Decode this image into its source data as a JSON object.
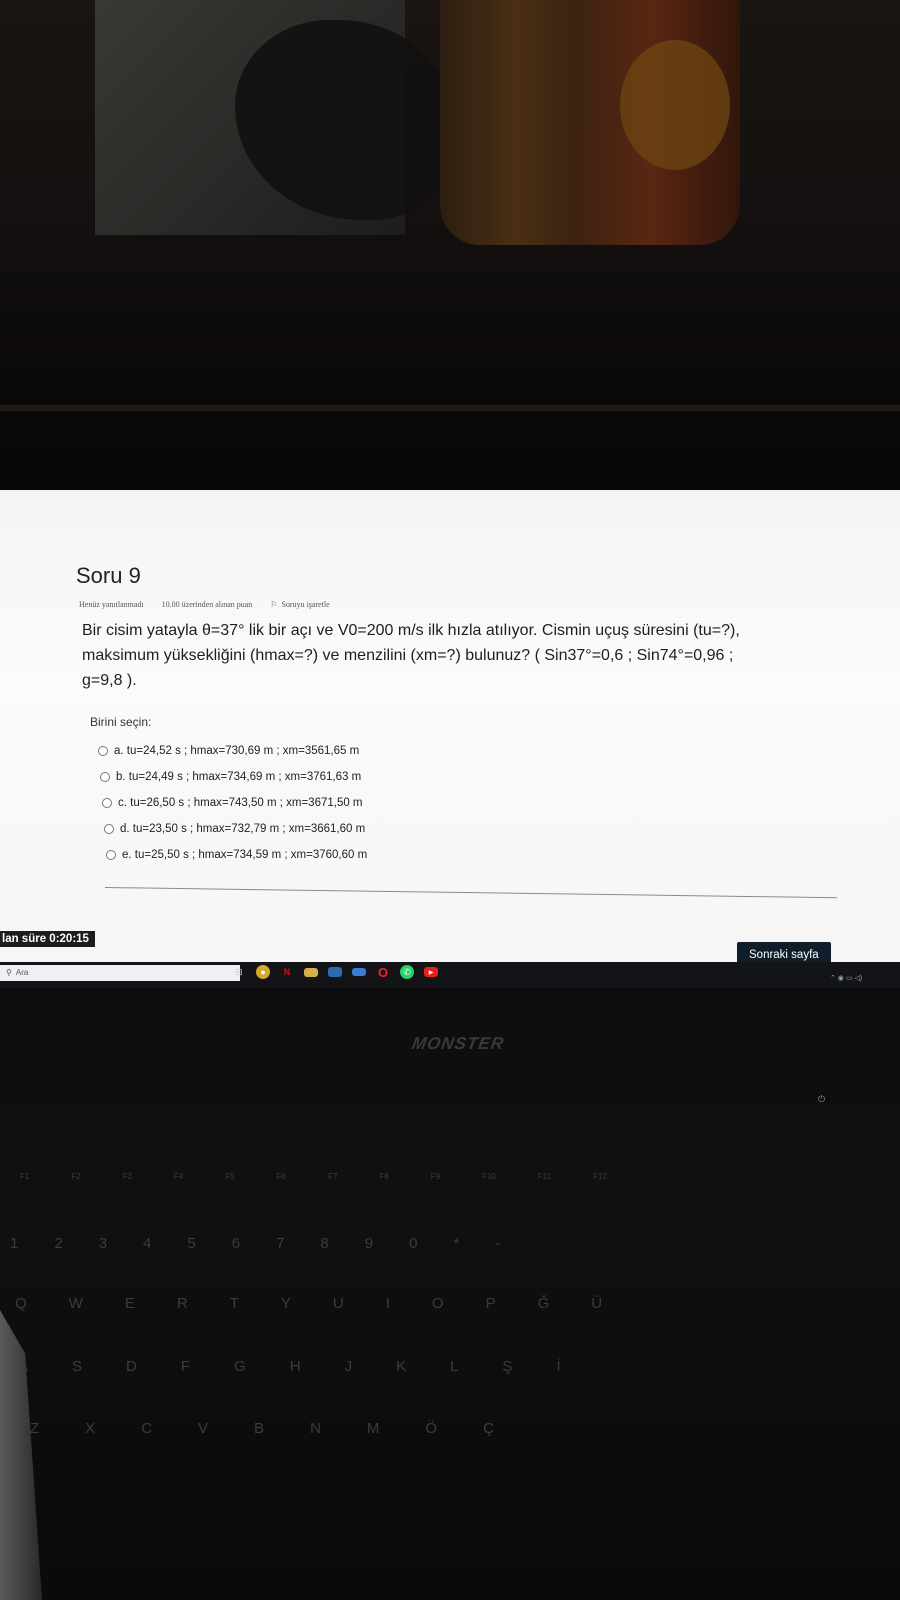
{
  "question": {
    "title": "Soru 9",
    "status": "Henüz yanıtlanmadı",
    "points": "10.00 üzerinden alınan puan",
    "flag_label": "Soruyu işaretle",
    "text_line1": "Bir cisim yatayla  θ=37° lik bir açı ve  V0=200 m/s ilk hızla atılıyor. Cismin uçuş süresini (tu=?),",
    "text_line2": "maksimum yüksekliğini (hmax=?) ve menzilini (xm=?) bulunuz? ( Sin37°=0,6 ;  Sin74°=0,96   ;",
    "text_line3": "g=9,8 )."
  },
  "answer": {
    "prompt": "Birini seçin:",
    "options": [
      {
        "label": "a. tu=24,52 s ;  hmax=730,69 m  ; xm=3561,65 m",
        "selected": false
      },
      {
        "label": "b. tu=24,49 s ;  hmax=734,69 m  ;  xm=3761,63 m",
        "selected": false
      },
      {
        "label": "c. tu=26,50 s ;  hmax=743,50 m  ; xm=3671,50 m",
        "selected": false
      },
      {
        "label": "d. tu=23,50 s ;  hmax=732,79 m  ; xm=3661,60 m",
        "selected": false
      },
      {
        "label": "e. tu=25,50 s ;  hmax=734,59 m  ; xm=3760,60 m",
        "selected": false
      }
    ]
  },
  "footer": {
    "timer": "lan süre 0:20:15",
    "next_button": "Sonraki sayfa"
  },
  "taskbar": {
    "search_placeholder": "Ara",
    "apps": [
      "task-view-icon",
      "chrome-icon",
      "netflix-icon",
      "file-explorer-icon",
      "store-icon",
      "mail-icon",
      "opera-icon",
      "whatsapp-icon",
      "youtube-icon"
    ]
  },
  "laptop": {
    "brand": "MONSTER"
  },
  "colors": {
    "page_bg": "#f6f6f6",
    "next_button": "#0f1d2a",
    "timer_bg": "#1d1d1d",
    "taskbar": "#121418"
  }
}
